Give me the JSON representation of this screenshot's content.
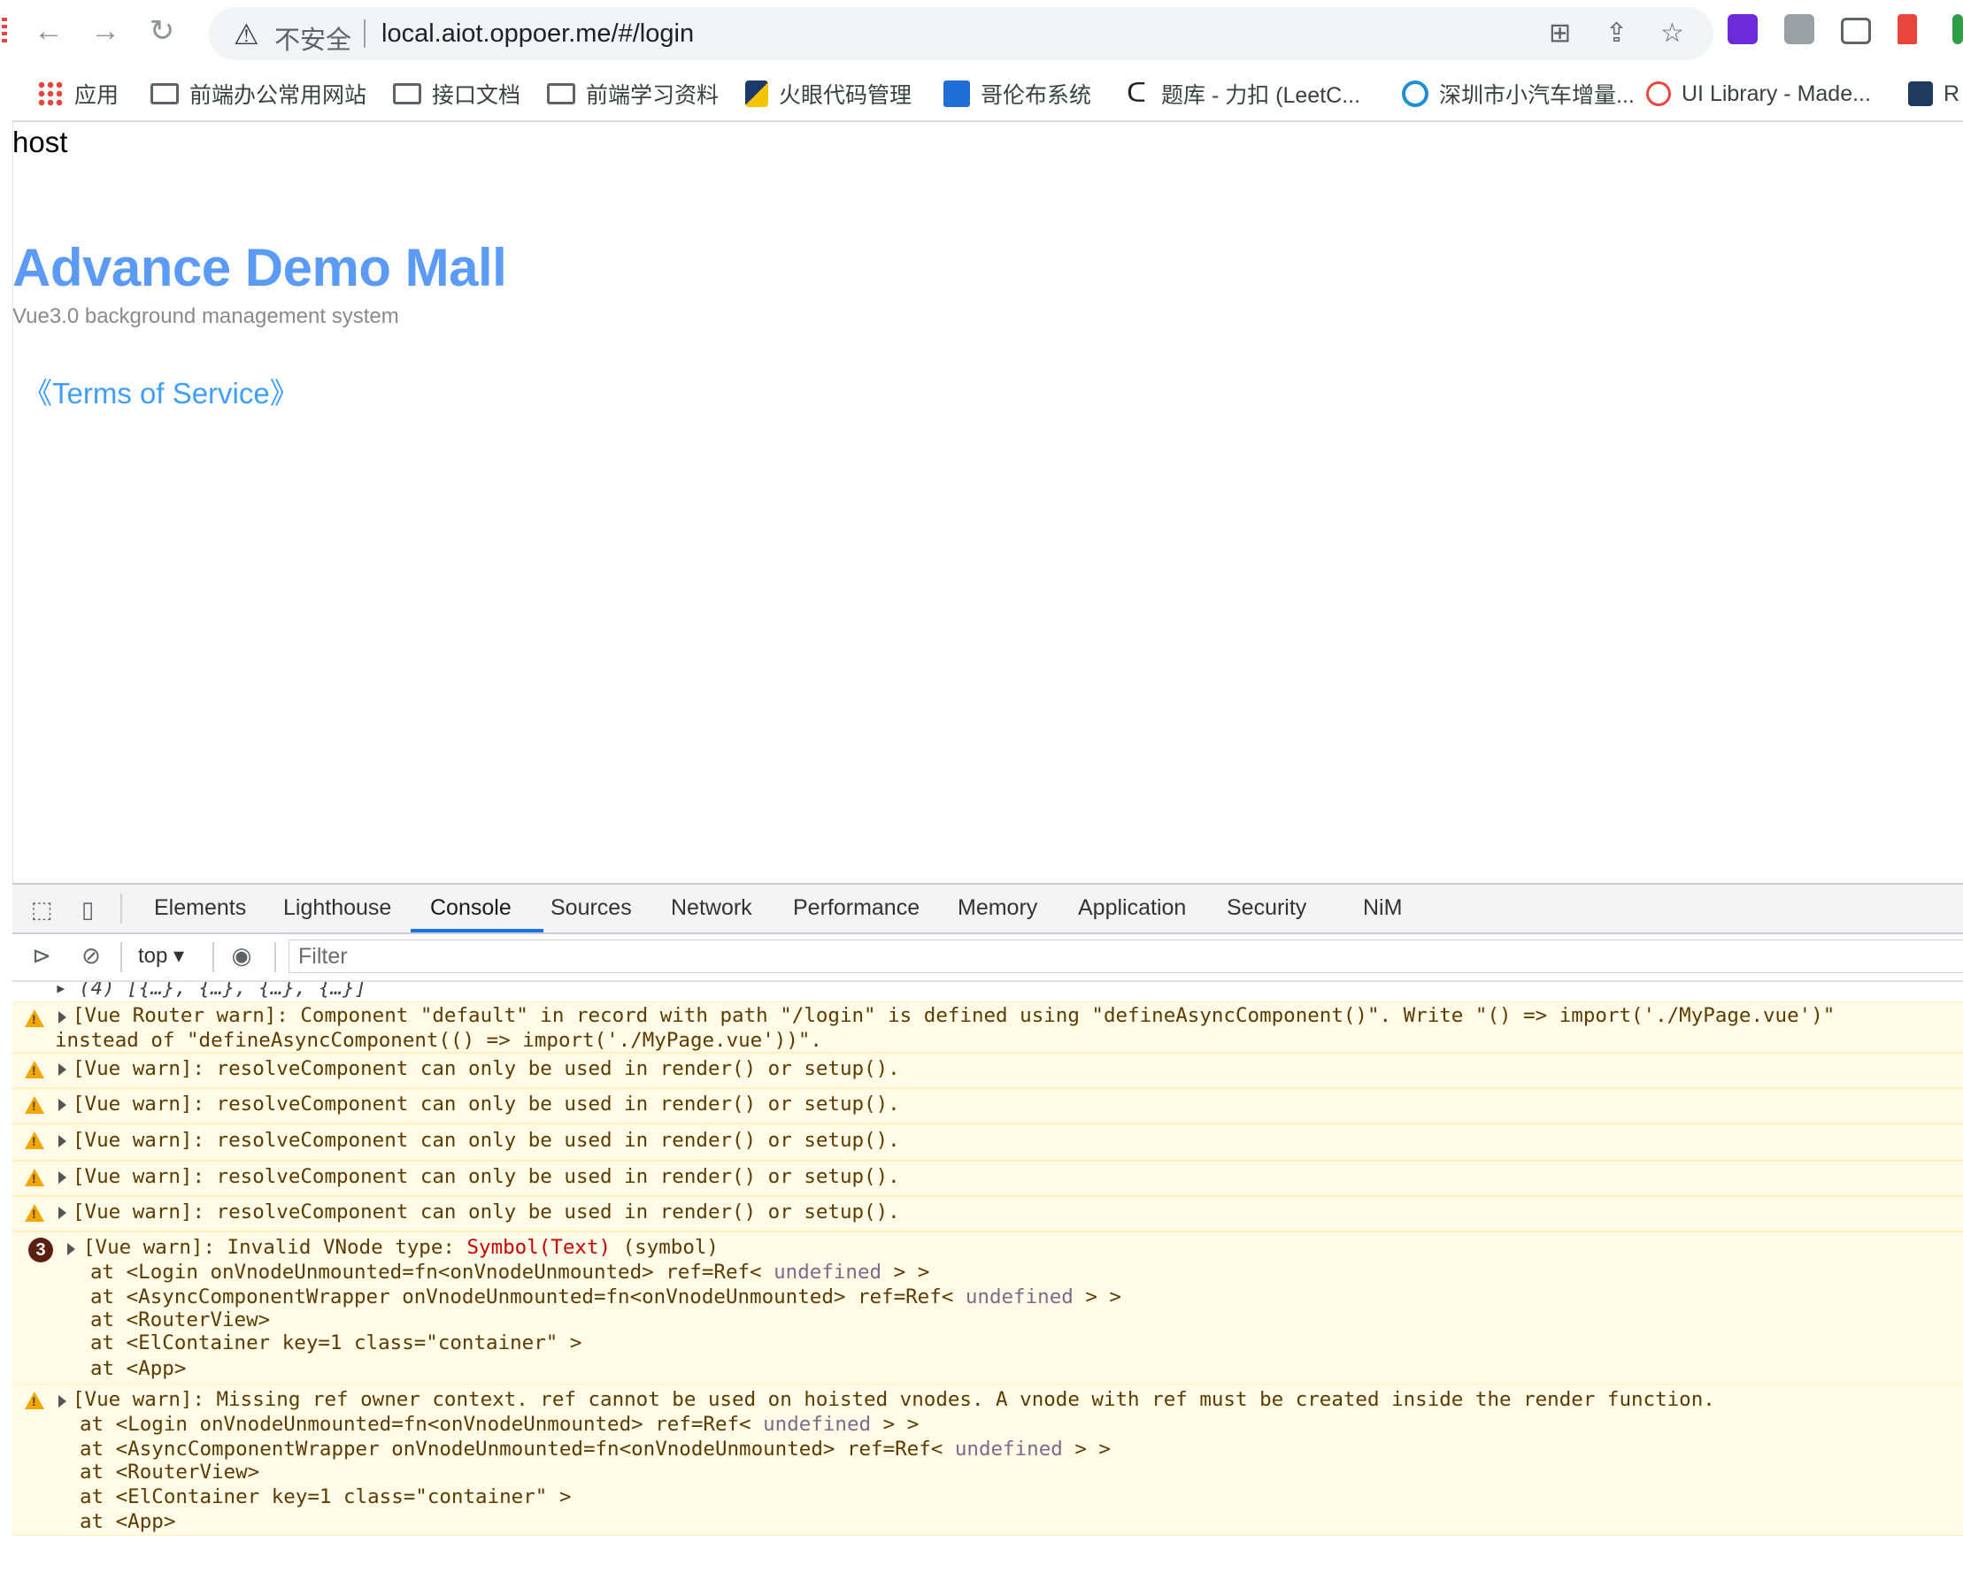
{
  "browser": {
    "insecure_label": "不安全",
    "url": "local.aiot.oppoer.me/#/login",
    "icons": [
      "back-icon",
      "forward-icon",
      "reload-icon",
      "warning-icon",
      "translate-icon",
      "share-icon",
      "star-icon"
    ]
  },
  "bookmarks": [
    {
      "label": "应用",
      "icon": "apps-grid-icon"
    },
    {
      "label": "前端办公常用网站",
      "icon": "folder-icon"
    },
    {
      "label": "接口文档",
      "icon": "folder-icon"
    },
    {
      "label": "前端学习资料",
      "icon": "folder-icon"
    },
    {
      "label": "火眼代码管理",
      "icon": "site-icon"
    },
    {
      "label": "哥伦布系统",
      "icon": "site-icon"
    },
    {
      "label": "题库 - 力扣 (LeetC...",
      "icon": "leetcode-icon"
    },
    {
      "label": "深圳市小汽车增量...",
      "icon": "site-icon"
    },
    {
      "label": "UI Library - Made...",
      "icon": "site-icon"
    },
    {
      "label": "R",
      "icon": "site-icon"
    }
  ],
  "page": {
    "host_text": "host",
    "brand_title": "Advance Demo Mall",
    "subtitle": "Vue3.0 background management system",
    "terms_link": "《Terms of Service》"
  },
  "devtools": {
    "tabs": [
      "Elements",
      "Lighthouse",
      "Console",
      "Sources",
      "Network",
      "Performance",
      "Memory",
      "Application",
      "Security",
      "NiM"
    ],
    "active_tab": "Console",
    "context": "top ▾",
    "filter_placeholder": "Filter",
    "colors": {
      "warning_bg": "#fffbe6",
      "accent": "#1a73e8",
      "error": "#c80000"
    }
  },
  "console": {
    "array_line": "▸ (4) [{…}, {…}, {…}, {…}]",
    "router_warn_1": "[Vue Router warn]: Component \"default\" in record with path \"/login\" is defined using \"defineAsyncComponent()\". Write \"() => import('./MyPage.vue')\"",
    "router_warn_2": "instead of \"defineAsyncComponent(() => import('./MyPage.vue'))\".",
    "resolve_warn": "[Vue warn]: resolveComponent can only be used in render() or setup().",
    "error_count": "3",
    "vnode_prefix": "[Vue warn]: Invalid VNode type: ",
    "vnode_symbol": "Symbol(Text)",
    "vnode_suffix": " (symbol)",
    "trace_login_a": "at <Login onVnodeUnmounted=fn<onVnodeUnmounted> ref=Ref< ",
    "trace_async_a": "at <AsyncComponentWrapper onVnodeUnmounted=fn<onVnodeUnmounted> ref=Ref< ",
    "undefined_word": "undefined",
    "trace_close": " > >",
    "trace_routerview": "at <RouterView>",
    "trace_container": "at <ElContainer key=1 class=\"container\" >",
    "trace_app": "at <App>",
    "missing_ref_warn": "[Vue warn]: Missing ref owner context. ref cannot be used on hoisted vnodes. A vnode with ref must be created inside the render function."
  }
}
